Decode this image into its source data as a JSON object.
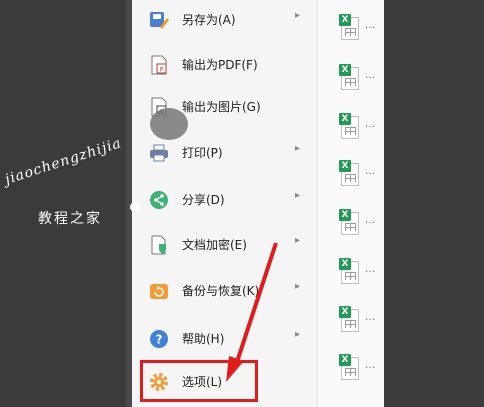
{
  "menu": {
    "items": [
      {
        "label": "另存为(A)",
        "icon": "save-as-icon",
        "submenu": true
      },
      {
        "label": "输出为PDF(F)",
        "icon": "pdf-export-icon",
        "submenu": false
      },
      {
        "label": "输出为图片(G)",
        "icon": "image-export-icon",
        "submenu": false
      },
      {
        "label": "打印(P)",
        "icon": "printer-icon",
        "submenu": true
      },
      {
        "label": "分享(D)",
        "icon": "share-icon",
        "submenu": true
      },
      {
        "label": "文档加密(E)",
        "icon": "lock-document-icon",
        "submenu": true
      },
      {
        "label": "备份与恢复(K)",
        "icon": "backup-restore-icon",
        "submenu": true
      },
      {
        "label": "帮助(H)",
        "icon": "help-icon",
        "submenu": true
      },
      {
        "label": "选项(L)",
        "icon": "gear-icon",
        "submenu": false
      }
    ]
  },
  "files": {
    "icon_letter": "X",
    "previews": [
      "…",
      "…",
      "…",
      "…",
      "…",
      "…",
      "…",
      "…"
    ]
  },
  "watermark": {
    "line1": "jiaochengzhijia",
    "line2": "教程之家"
  },
  "colors": {
    "highlight": "#e21b1b",
    "excel_green": "#1f9d55"
  }
}
